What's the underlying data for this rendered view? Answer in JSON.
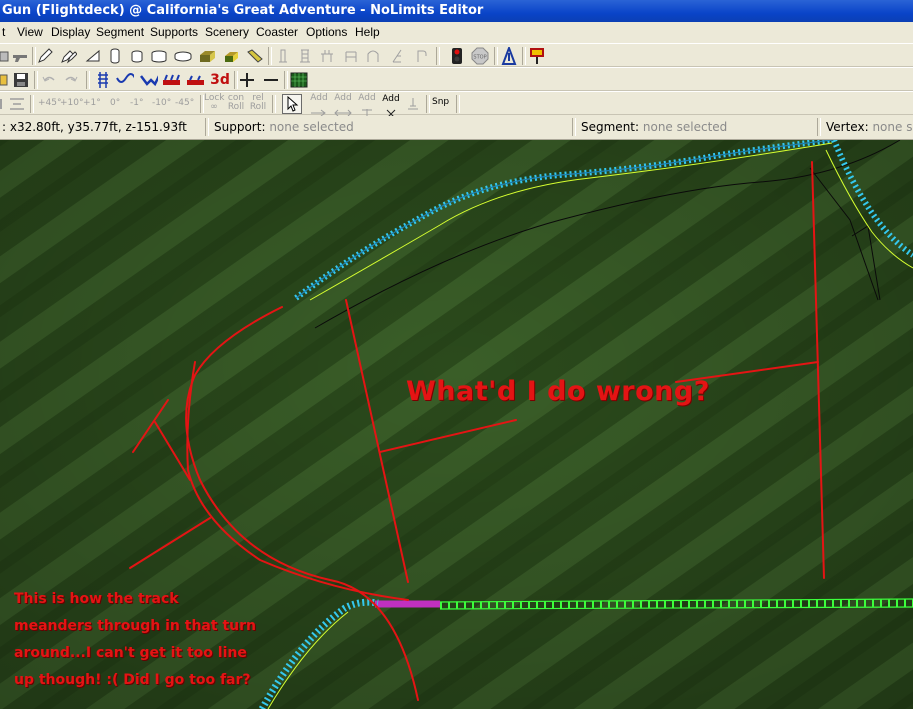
{
  "window": {
    "title": "Gun (Flightdeck) @ California's Great Adventure - NoLimits Editor"
  },
  "menu": {
    "items": [
      "t",
      "View",
      "Display",
      "Segment",
      "Supports",
      "Scenery",
      "Coaster",
      "Options",
      "Help"
    ]
  },
  "toolbar3": {
    "angle_buttons": [
      "+45°",
      "+10°",
      "+1°",
      "0°",
      "-1°",
      "-10°",
      "-45°"
    ],
    "lock_roll": [
      "Lock",
      "∞"
    ],
    "con_roll": [
      "con",
      "Roll"
    ],
    "rel_roll": [
      "rel",
      "Roll"
    ],
    "add_label": "Add",
    "snap_label": "Snp"
  },
  "toolbar2": {
    "view_3d_label": "3d"
  },
  "statusbar": {
    "coords": ": x32.80ft, y35.77ft, z-151.93ft",
    "support_label": "Support:",
    "support_value": "none selected",
    "segment_label": "Segment:",
    "segment_value": "none selected",
    "vertex_label": "Vertex:",
    "vertex_value": "none s"
  },
  "annotations": {
    "question": "What'd I do wrong?",
    "explanation_lines": [
      "This is how the track",
      "meanders through in that turn",
      "around...I can't get it too line",
      "up though! :( Did I go too far?"
    ]
  },
  "colors": {
    "annotation": "#e41414",
    "track_cyan": "#34c8ee",
    "track_green": "#3cff3c",
    "grass": "#2f4f1f",
    "title_bar": "#0a44c8"
  }
}
